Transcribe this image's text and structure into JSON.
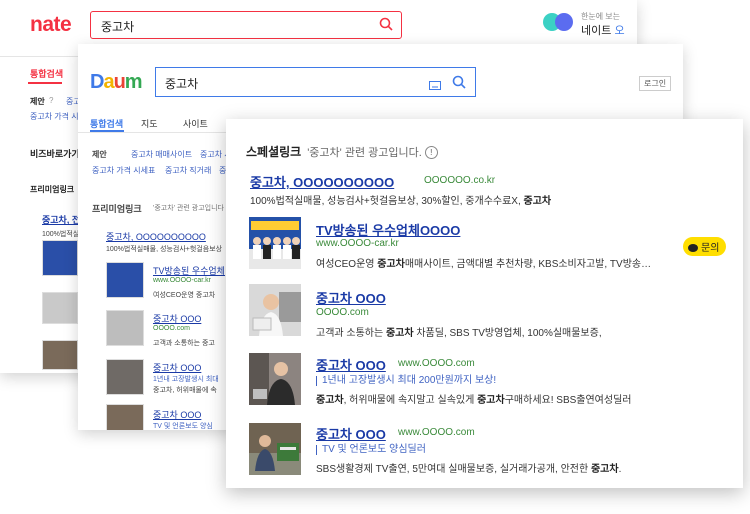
{
  "nate": {
    "logo": "nate",
    "query": "중고차",
    "right_small": "한눈에 보는",
    "right_large": "네이트",
    "right_large_accent": "오",
    "tab_active": "통합검색",
    "suggest_label": "제안",
    "suggest_val": "중고",
    "row1": "중고차 가격 시세",
    "biz_title": "비즈바로가기",
    "premium_title": "프리미엄링크",
    "result1_title": "중고차, 전",
    "result1_desc": "100%법적실",
    "colors": {
      "brand": "#f43142",
      "dot1": "#3bd1c4",
      "dot2": "#5b6cf0"
    }
  },
  "daum": {
    "logo": [
      "D",
      "a",
      "u",
      "m"
    ],
    "query": "중고차",
    "login": "로그인",
    "tabs": [
      "통합검색",
      "지도",
      "사이트"
    ],
    "suggest_label": "제안",
    "suggest_items": [
      "중고차 매매사이트",
      "중고차 시"
    ],
    "suggest_row2": [
      "중고차 가격 시세표",
      "중고차 직거래",
      "중"
    ],
    "premium_title": "프리미엄링크",
    "premium_sub": "'중고차' 관련 광고입니다",
    "items": [
      {
        "title": "중고차, OOOOOOOOOO",
        "url": "",
        "desc": "100%법적실매물, 성능검사+헛걸음보상"
      },
      {
        "title": "TV방송된 우수업체",
        "url": "www.OOOO-car.kr",
        "desc": "여성CEO운영 중고차"
      },
      {
        "title": "중고차 OOO",
        "url": "OOOO.com",
        "desc": "고객과 소통하는 중고"
      },
      {
        "title": "중고차 OOO",
        "url": "",
        "desc1": "1년내 고장발생시 최대",
        "desc2": "중고차, 허위매물에 속"
      },
      {
        "title": "중고차 OOO",
        "url": "",
        "desc1": "TV 및 언론보도 양심",
        "desc2": "SBS생활경제 TV출연"
      }
    ],
    "colors": {
      "brand": "#3f7ae8"
    }
  },
  "main": {
    "header_title": "스페셜링크",
    "header_sub": "'중고차' 관련 광고입니다.",
    "info_icon_text": "!",
    "badge": "문의",
    "items": [
      {
        "title": "중고차, OOOOOOOOOO",
        "url": "OOOOOO.co.kr",
        "desc_pre": "100%법적실매물, 성능검사+헛걸음보상, 30%할인, 중개수수료X, ",
        "desc_bold": "중고차",
        "desc_post": ""
      },
      {
        "title": "TV방송된 우수업체OOOO",
        "url": "www.OOOO-car.kr",
        "desc_pre": "여성CEO운영 ",
        "desc_bold": "중고차",
        "desc_post": "매매사이트, 금액대별 추천차량, KBS소비자고발, TV방송…"
      },
      {
        "title": "중고차 OOO",
        "url": "OOOO.com",
        "desc_pre": "고객과 소통하는 ",
        "desc_bold": "중고차",
        "desc_post": " 차품딜, SBS TV방영업체, 100%실매물보증,"
      },
      {
        "title": "중고차 OOO",
        "url": "www.OOOO.com",
        "blue": "1년내 고장발생시 최대 200만원까지 보상!",
        "desc_bold": "중고차",
        "desc_post": ", 허위매물에 속지말고 실속있게 ",
        "desc_bold2": "중고차",
        "desc_post2": "구매하세요! SBS출연여성딜러"
      },
      {
        "title": "중고차 OOO",
        "url": "www.OOOO.com",
        "blue": "TV 및 언론보도 양심딜러",
        "desc_pre": "SBS생활경제 TV출연, 5만여대 실매물보증, 실거래가공개, 안전한 ",
        "desc_bold": "중고차",
        "desc_post": "."
      }
    ],
    "colors": {
      "title": "#1a3aa6",
      "url": "#3a8a3a",
      "badge": "#ffde00"
    }
  }
}
